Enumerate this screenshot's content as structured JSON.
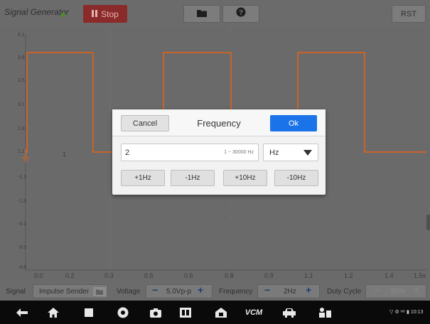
{
  "toolbar": {
    "title": "Signal Generator",
    "stop_label": "Stop",
    "folder_icon": "folder-icon",
    "help_icon": "help-icon",
    "rst_label": "RST",
    "accent_stop": "#8a2a2a"
  },
  "plot": {
    "y_ticks": [
      "5.1",
      "3.8",
      "3.5",
      "3.1",
      "1.8",
      "1.1",
      "-1.1",
      "-1.8",
      "-3.1",
      "-3.5",
      "-3.8",
      "-5.1"
    ],
    "x_ticks": [
      "0.0",
      "0.2",
      "0.3",
      "0.5",
      "0.6",
      "0.8",
      "0.9",
      "1.1",
      "1.2",
      "1.4",
      "1.5s"
    ],
    "marker_label": "1",
    "waveform_color": "#c8642a"
  },
  "controls": {
    "signal_label": "Signal",
    "signal_value": "Impulse Sender",
    "voltage_label": "Voltage",
    "voltage_value": "5.0Vp-p",
    "frequency_label": "Frequency",
    "frequency_value": "2Hz",
    "duty_label": "Duty Cycle",
    "duty_value": "50%",
    "minus": "−",
    "plus": "+"
  },
  "dialog": {
    "cancel_label": "Cancel",
    "title": "Frequency",
    "ok_label": "Ok",
    "input_value": "2",
    "input_range": "1 ~ 30000 Hz",
    "unit_value": "Hz",
    "steps": [
      "+1Hz",
      "-1Hz",
      "+10Hz",
      "-10Hz"
    ],
    "accent_ok": "#1a73e8"
  },
  "navbar": {
    "vcm_label": "VCM",
    "status": "▽ ⚙ ᵛᵉʳ ▮ 10:13"
  }
}
